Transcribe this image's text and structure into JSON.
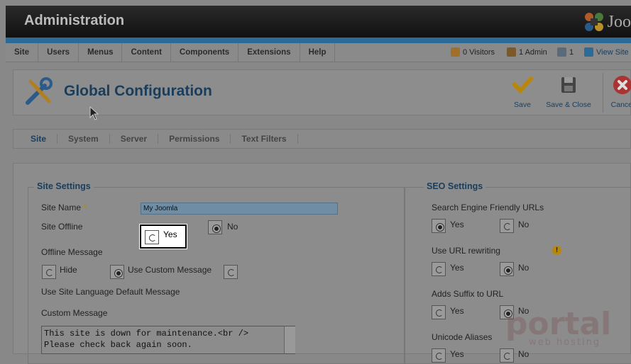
{
  "header": {
    "title": "Administration",
    "logo_text": "Joo"
  },
  "menu": {
    "items": [
      "Site",
      "Users",
      "Menus",
      "Content",
      "Components",
      "Extensions",
      "Help"
    ],
    "status": {
      "visitors": "0 Visitors",
      "admins": "1 Admin",
      "messages": "1",
      "view_site": "View Site"
    }
  },
  "toolbar": {
    "page_title": "Global Configuration",
    "save_label": "Save",
    "save_close_label": "Save & Close",
    "cancel_label": "Cancel"
  },
  "subtabs": [
    "Site",
    "System",
    "Server",
    "Permissions",
    "Text Filters"
  ],
  "site_settings": {
    "legend": "Site Settings",
    "site_name_label": "Site Name",
    "site_name_required": "*",
    "site_name_value": "My Joomla",
    "site_offline_label": "Site Offline",
    "offline_yes": "Yes",
    "offline_no": "No",
    "offline_message_label": "Offline Message",
    "hide_label": "Hide",
    "use_custom_label": "Use Custom Message",
    "use_language_default_label": "Use Site Language Default Message",
    "custom_message_label": "Custom Message",
    "custom_message_value": "This site is down for maintenance.<br />\nPlease check back again soon."
  },
  "seo_settings": {
    "legend": "SEO Settings",
    "sef_label": "Search Engine Friendly URLs",
    "rewrite_label": "Use URL rewriting",
    "suffix_label": "Adds Suffix to URL",
    "unicode_label": "Unicode Aliases",
    "yes": "Yes",
    "no": "No"
  },
  "watermark": {
    "main": "portal",
    "sub": "web hosting"
  },
  "colors": {
    "accent": "#2c6b98",
    "title": "#1a3d5c",
    "required": "#b8860b"
  }
}
